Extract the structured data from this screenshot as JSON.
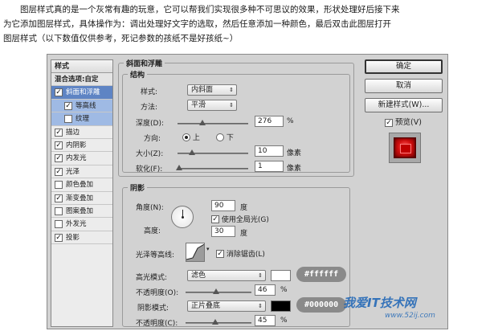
{
  "intro": {
    "line1": "图层样式真的是一个灰常有趣的玩意，它可以帮我们实现很多种不可思议的效果，形状处理好后接下来",
    "line2": "为它添加图层样式，具体操作为：调出处理好文字的选取，然后任意添加一种颜色，最后双击此图层打开",
    "line3": "图层样式（以下数值仅供参考，死记参数的孩纸不是好孩纸~）"
  },
  "style_list": {
    "header": "样式",
    "blend_options": "混合选项:自定",
    "items": [
      {
        "label": "斜面和浮雕",
        "checked": true
      },
      {
        "label": "等高线",
        "checked": true
      },
      {
        "label": "纹理",
        "checked": false
      },
      {
        "label": "描边",
        "checked": true
      },
      {
        "label": "内阴影",
        "checked": true
      },
      {
        "label": "内发光",
        "checked": true
      },
      {
        "label": "光泽",
        "checked": true
      },
      {
        "label": "颜色叠加",
        "checked": false
      },
      {
        "label": "渐变叠加",
        "checked": true
      },
      {
        "label": "图案叠加",
        "checked": false
      },
      {
        "label": "外发光",
        "checked": false
      },
      {
        "label": "投影",
        "checked": true
      }
    ],
    "check_mark": "✓"
  },
  "bevel": {
    "title": "斜面和浮雕",
    "structure_title": "结构",
    "style_label": "样式:",
    "style_value": "内斜面",
    "method_label": "方法:",
    "method_value": "平滑",
    "depth_label": "深度(D):",
    "depth_value": "276",
    "depth_unit": "%",
    "depth_level": 0.35,
    "direction_label": "方向:",
    "direction_up": "上",
    "direction_down": "下",
    "size_label": "大小(Z):",
    "size_value": "10",
    "size_unit": "像素",
    "size_level": 0.2,
    "soften_label": "软化(F):",
    "soften_value": "1",
    "soften_unit": "像素",
    "soften_level": 0.02
  },
  "shading": {
    "title": "阴影",
    "angle_label": "角度(N):",
    "angle_value": "90",
    "angle_unit": "度",
    "global_light_label": "使用全局光(G)",
    "altitude_label": "高度:",
    "altitude_value": "30",
    "altitude_unit": "度",
    "gloss_label": "光泽等高线:",
    "antialias_label": "消除锯齿(L)",
    "highlight_label": "高光模式:",
    "highlight_mode": "滤色",
    "highlight_color": "#ffffff",
    "highlight_hex": "#ffffff",
    "highlight_opacity_label": "不透明度(O):",
    "highlight_opacity": "46",
    "highlight_opacity_level": 0.46,
    "shadow_label": "阴影模式:",
    "shadow_mode": "正片叠底",
    "shadow_color": "#000000",
    "shadow_hex": "#000000",
    "shadow_opacity_label": "不透明度(C):",
    "shadow_opacity": "45",
    "shadow_opacity_level": 0.45,
    "percent": "%"
  },
  "buttons": {
    "ok": "确定",
    "cancel": "取消",
    "new_style": "新建样式(W)...",
    "preview_label": "预览(V)"
  },
  "watermark": {
    "main": "我爱IT技术网",
    "sub": "www.52ij.com"
  }
}
